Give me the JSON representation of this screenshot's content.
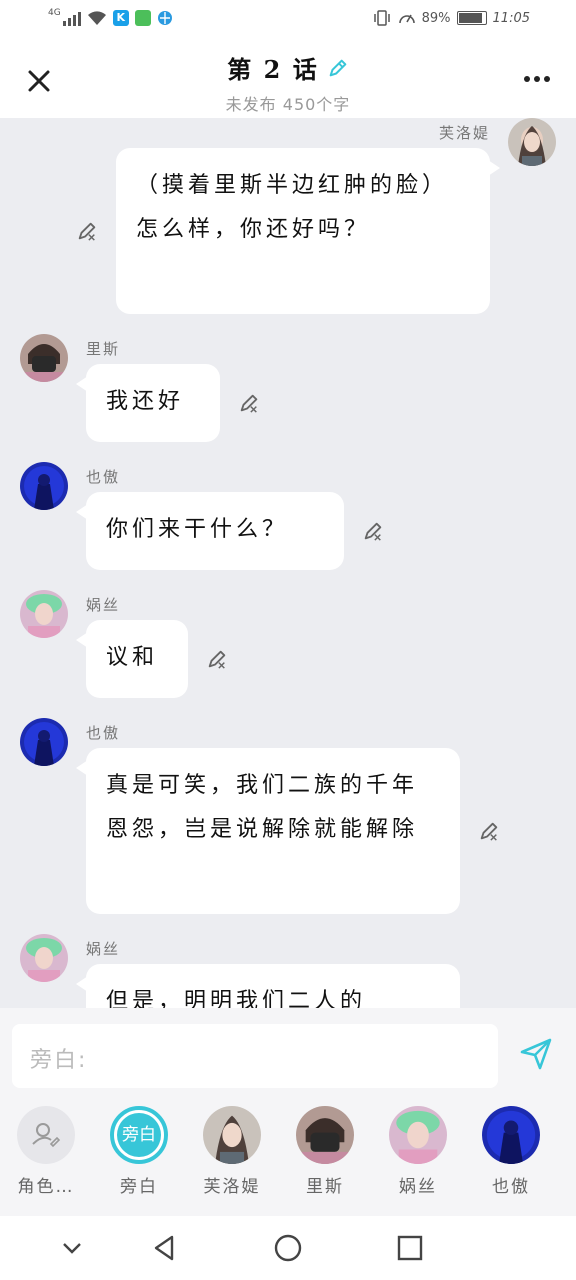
{
  "status_bar": {
    "network": "4G",
    "battery": "89%",
    "time": "11:05"
  },
  "header": {
    "title": "第 2 话",
    "subtitle": "未发布 450个字"
  },
  "messages": [
    {
      "name": "芙洛媞",
      "text": "（摸着里斯半边红肿的脸）怎么样，你还好吗？",
      "side": "right",
      "avatar": "woman-portrait-avatar"
    },
    {
      "name": "里斯",
      "text": "我还好",
      "side": "left",
      "avatar": "masked-man-avatar"
    },
    {
      "name": "也傲",
      "text": "你们来干什么？",
      "side": "left",
      "avatar": "blue-warrior-avatar"
    },
    {
      "name": "娲丝",
      "text": "议和",
      "side": "left",
      "avatar": "green-hair-woman-avatar"
    },
    {
      "name": "也傲",
      "text": "真是可笑，我们二族的千年恩怨，岂是说解除就能解除",
      "side": "left",
      "avatar": "blue-warrior-avatar"
    },
    {
      "name": "娲丝",
      "text": "但是，明明我们二人的",
      "side": "left",
      "avatar": "green-hair-woman-avatar"
    }
  ],
  "input": {
    "placeholder": "旁白:"
  },
  "roles": [
    {
      "label": "角色…",
      "icon": "person-edit-icon"
    },
    {
      "label": "旁白",
      "badge": "旁白"
    },
    {
      "label": "芙洛媞"
    },
    {
      "label": "里斯"
    },
    {
      "label": "娲丝"
    },
    {
      "label": "也傲"
    }
  ],
  "colors": {
    "accent": "#37c6d8",
    "chat_bg": "#ecedf1",
    "bubble": "#ffffff"
  }
}
